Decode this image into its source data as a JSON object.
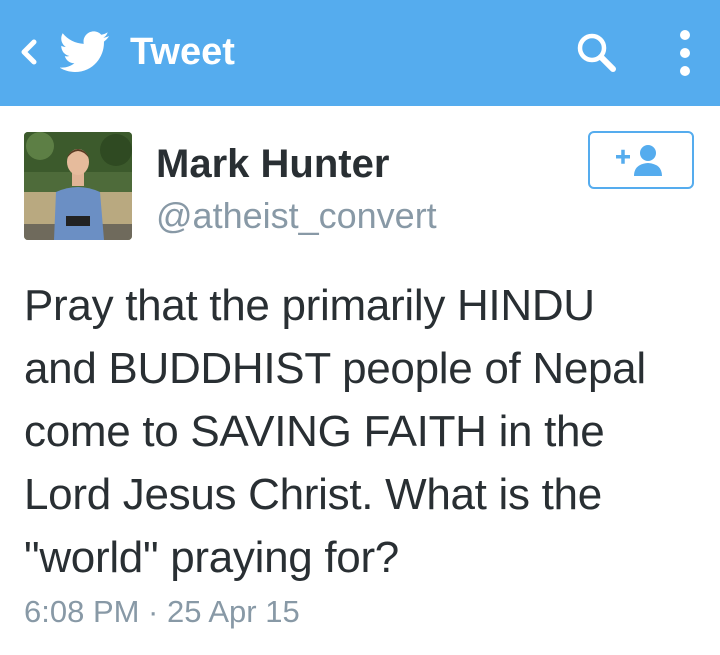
{
  "app_bar": {
    "title": "Tweet",
    "color": "#55acee",
    "icons": {
      "back": "chevron-left-icon",
      "logo": "twitter-bird-icon",
      "search": "search-icon",
      "overflow": "overflow-menu-icon"
    }
  },
  "tweet": {
    "author": {
      "display_name": "Mark Hunter",
      "handle": "@atheist_convert",
      "avatar": "avatar-photo"
    },
    "follow_button": {
      "icon": "add-user-icon",
      "color": "#55acee"
    },
    "lines": [
      "Pray that the primarily HINDU",
      "and BUDDHIST people of Nepal",
      "come to SAVING FAITH in the",
      "Lord Jesus Christ. What is the",
      "\"world\" praying for?"
    ],
    "timestamp": "6:08 PM · 25 Apr 15"
  }
}
